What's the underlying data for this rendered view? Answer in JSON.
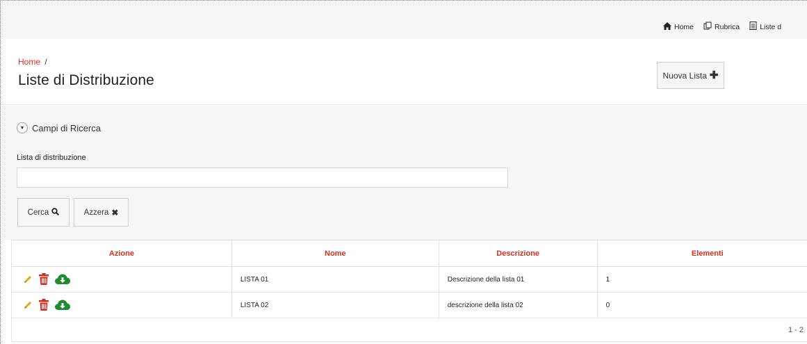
{
  "topnav": {
    "items": [
      {
        "label": "Home",
        "icon": "home-icon"
      },
      {
        "label": "Rubrica",
        "icon": "address-book-icon"
      },
      {
        "label": "Liste d",
        "icon": "document-icon"
      }
    ]
  },
  "header": {
    "breadcrumb_home": "Home",
    "breadcrumb_sep": "/",
    "title": "Liste di Distribuzione",
    "new_button_label": "Nuova Lista"
  },
  "search": {
    "panel_title": "Campi di Ricerca",
    "field_label": "Lista di distribuzione",
    "field_value": "",
    "search_label": "Cerca",
    "reset_label": "Azzera"
  },
  "table": {
    "columns": [
      "Azione",
      "Nome",
      "Descrizione",
      "Elementi"
    ],
    "rows": [
      {
        "nome": "LISTA 01",
        "descrizione": "Descrizione della lista 01",
        "elementi": "1"
      },
      {
        "nome": "LISTA 02",
        "descrizione": "descrizione della lista 02",
        "elementi": "0"
      }
    ],
    "pagination": "1 - 2"
  },
  "colors": {
    "accent": "#d9301c",
    "edit_icon": "#e8a213",
    "delete_icon": "#d32b1e",
    "download_icon": "#1e8c2f"
  }
}
